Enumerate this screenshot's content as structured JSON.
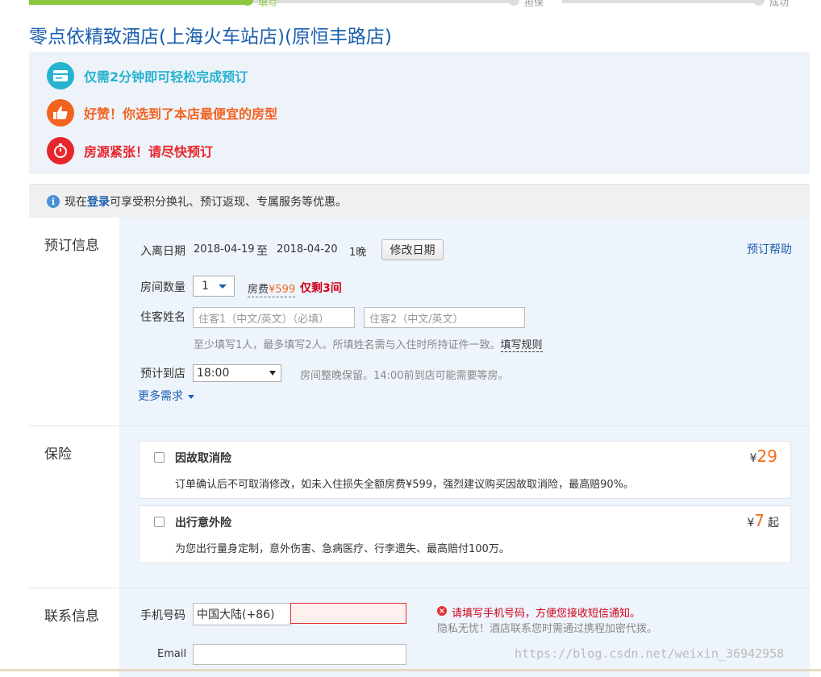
{
  "progress": {
    "steps": [
      "填写",
      "担保",
      "成功"
    ]
  },
  "hotel": {
    "title": "零点依精致酒店(上海火车站店)(原恒丰路店)"
  },
  "promo": {
    "items": [
      {
        "text": "仅需2分钟即可轻松完成预订",
        "icon": "card-icon",
        "color": "#27b2cf"
      },
      {
        "text": "好赞！你选到了本店最便宜的房型",
        "icon": "thumbs-up-icon",
        "color": "#f3621f"
      },
      {
        "text": "房源紧张！请尽快预订",
        "icon": "stopwatch-icon",
        "color": "#e7262c"
      }
    ]
  },
  "login_bar": {
    "prefix": "现在",
    "link": "登录",
    "suffix": "可享受积分换礼、预订返现、专属服务等优惠。"
  },
  "booking": {
    "section_title": "预订信息",
    "help_link": "预订帮助",
    "checkin_label": "入离日期",
    "checkin_date": "2018-04-19",
    "to": "至",
    "checkout_date": "2018-04-20",
    "nights": "1晚",
    "modify_button": "修改日期",
    "rooms_label": "房间数量",
    "rooms_value": "1",
    "room_fee_label": "房费",
    "room_fee_currency": "¥",
    "room_fee_value": "599",
    "rooms_left": "仅剩3间",
    "guest_label": "住客姓名",
    "guest1_placeholder": "住客1（中文/英文）（必填）",
    "guest2_placeholder": "住客2（中文/英文）",
    "guest_hint": "至少填写1人，最多填写2人。所填姓名需与入住时所持证件一致。",
    "guest_rule_link": "填写规则",
    "arrival_label": "预计到店",
    "arrival_value": "18:00",
    "arrival_hint": "房间整晚保留。14:00前到店可能需要等房。",
    "more_needs": "更多需求"
  },
  "insurance": {
    "section_title": "保险",
    "items": [
      {
        "name": "因故取消险",
        "desc": "订单确认后不可取消修改，如未入住损失全额房费¥599，强烈建议购买因故取消险，最高赔90%。",
        "currency": "¥",
        "price": "29",
        "suffix": ""
      },
      {
        "name": "出行意外险",
        "desc": "为您出行量身定制，意外伤害、急病医疗、行李遗失、最高赔付100万。",
        "currency": "¥",
        "price": "7",
        "suffix": "起"
      }
    ]
  },
  "contact": {
    "section_title": "联系信息",
    "phone_label": "手机号码",
    "country_code": "中国大陆(+86)",
    "phone_error": "请填写手机号码，方便您接收短信通知。",
    "privacy_note": "隐私无忧！酒店联系您时需通过携程加密代拨。",
    "email_label": "Email"
  },
  "watermark": "https://blog.csdn.net/weixin_36942958"
}
